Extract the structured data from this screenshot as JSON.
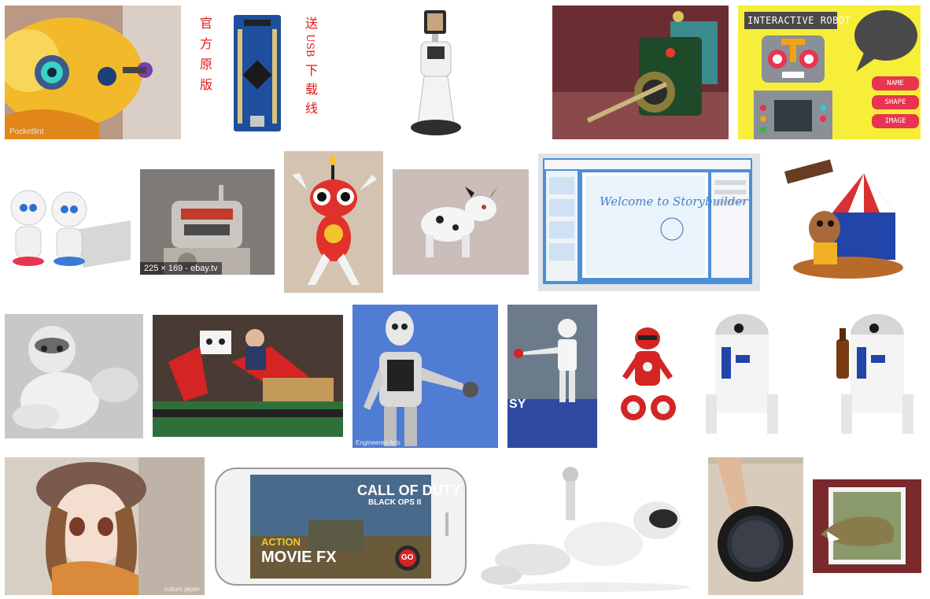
{
  "page": {
    "background": "#ffffff"
  },
  "tiles": {
    "t1": {
      "description_icon": "toy-robot-fish-image",
      "watermark": "Pocketlint"
    },
    "t2": {
      "description_icon": "arduino-board-image",
      "left_text": [
        "官",
        "方",
        "原",
        "版"
      ],
      "right_text": [
        "送",
        "USB",
        "下",
        "载",
        "线"
      ]
    },
    "t3": {
      "description_icon": "telepresence-robot-image"
    },
    "t4": {
      "description_icon": "circuit-board-robot-image"
    },
    "t5": {
      "description_icon": "interactive-robot-illustration",
      "title": "INTERACTIVE ROBOT",
      "buttons": [
        "NAME",
        "SHAPE",
        "IMAGE"
      ]
    },
    "t6": {
      "description_icon": "small-companion-robots-image"
    },
    "t7": {
      "description_icon": "vintage-tin-robot-image",
      "caption": "225 × 169 - ebay.tv"
    },
    "t8": {
      "description_icon": "toy-creature-robot-image"
    },
    "t9": {
      "description_icon": "robot-dog-image"
    },
    "t10": {
      "description_icon": "storybuilder-app-screenshot",
      "title": "Welcome to Storybuilder"
    },
    "t11": {
      "description_icon": "circus-tent-monkey-robot-image"
    },
    "t12": {
      "description_icon": "nao-humanoid-robot-image"
    },
    "t13": {
      "description_icon": "baxter-industrial-robot-image"
    },
    "t14": {
      "description_icon": "humanoid-robot-blue-background-image",
      "watermark": "Engineered Arts"
    },
    "t15": {
      "description_icon": "robot-playing-table-tennis-image",
      "watermark": "SY"
    },
    "t16": {
      "description_icon": "red-toy-robot-image"
    },
    "t17": {
      "description_icon": "r2d2-droid-image"
    },
    "t18": {
      "description_icon": "anime-doll-image",
      "watermark": "culture japan"
    },
    "t19": {
      "description_icon": "action-movie-fx-phone-image",
      "line1": "CALL OF DUTY",
      "line2": "BLACK OPS II",
      "line3": "ACTION",
      "line4": "MOVIE FX",
      "go": "GO"
    },
    "t20": {
      "description_icon": "reclining-robot-image"
    },
    "t21": {
      "description_icon": "smart-speaker-hand-image"
    },
    "t22": {
      "description_icon": "3d-dinosaur-frame-image"
    }
  },
  "colors": {
    "accent_red": "#e8344e",
    "ir_yellow": "#f7ee3a",
    "ebay_caption_bg": "#000000"
  }
}
